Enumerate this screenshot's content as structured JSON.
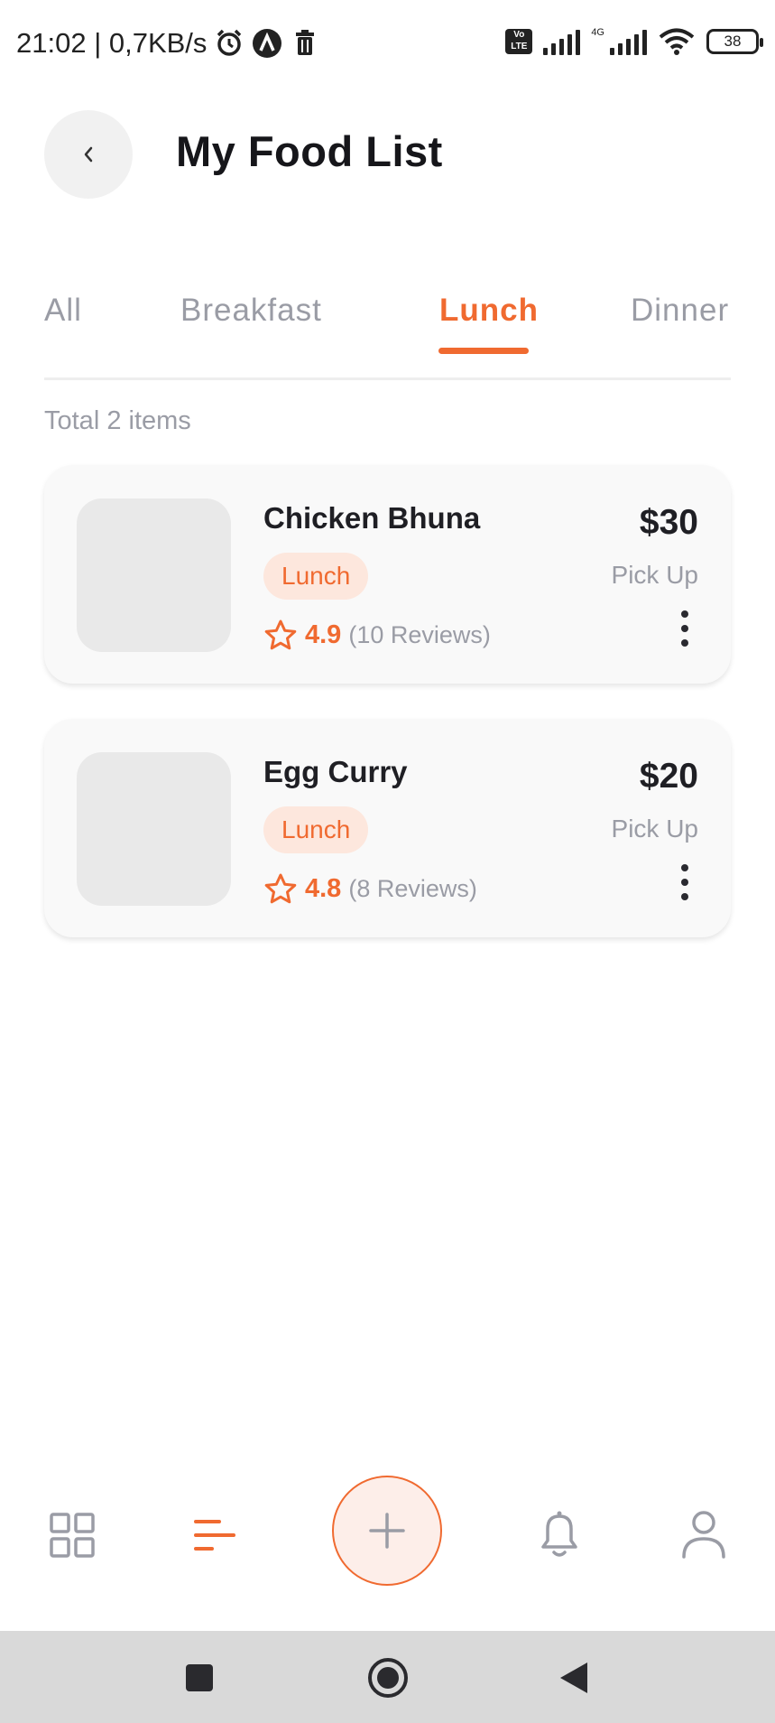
{
  "status_bar": {
    "time_speed": "21:02 | 0,7KB/s",
    "icons": [
      "alarm-icon",
      "app-a-icon",
      "trash-icon",
      "volte-icon",
      "signal-icon",
      "signal-4g-icon",
      "wifi-icon",
      "battery-icon"
    ],
    "volte_label": "Vo\nLTE",
    "net_label": "4G",
    "battery": "38"
  },
  "header": {
    "title": "My Food List",
    "back_icon": "chevron-left-icon"
  },
  "tabs": [
    {
      "label": "All",
      "active": false
    },
    {
      "label": "Breakfast",
      "active": false
    },
    {
      "label": "Lunch",
      "active": true
    },
    {
      "label": "Dinner",
      "active": false
    }
  ],
  "summary": "Total 2 items",
  "items": [
    {
      "name": "Chicken Bhuna",
      "category": "Lunch",
      "rating": "4.9",
      "reviews": "(10 Reviews)",
      "price": "$30",
      "mode": "Pick Up"
    },
    {
      "name": "Egg Curry",
      "category": "Lunch",
      "rating": "4.8",
      "reviews": "(8 Reviews)",
      "price": "$20",
      "mode": "Pick Up"
    }
  ],
  "bottom_nav": [
    "grid-icon",
    "list-icon",
    "plus-icon",
    "bell-icon",
    "user-icon"
  ],
  "colors": {
    "accent": "#f06a30",
    "badge_bg": "#fde7dd",
    "muted": "#9a9ca5",
    "card_bg": "#f9f9f9"
  }
}
